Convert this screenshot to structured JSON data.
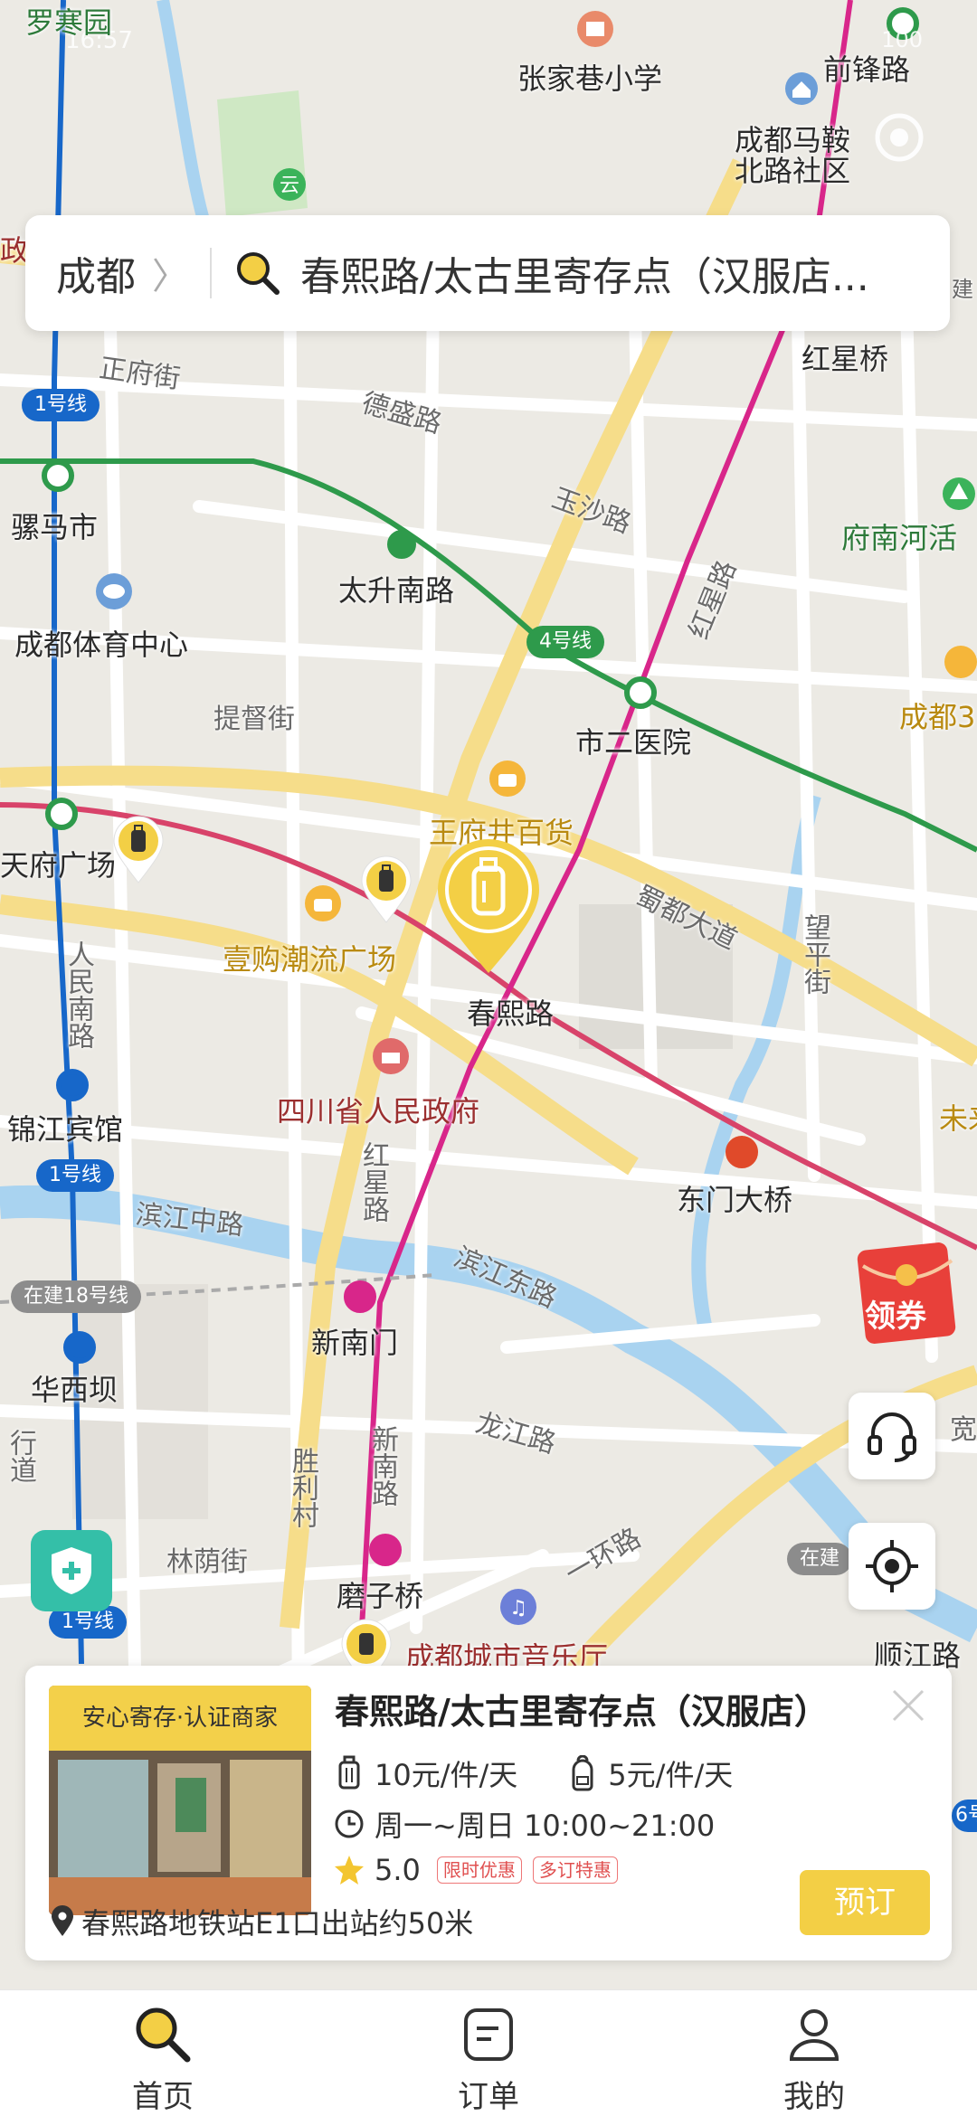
{
  "status_bar": {
    "time": "16:57",
    "battery": "100"
  },
  "search": {
    "city": "成都",
    "query": "春熙路/太古里寄存点（汉服店..."
  },
  "map": {
    "labels": {
      "luohan": "罗寒园",
      "zhangjia": "张家巷小学",
      "qianfeng": "前锋路",
      "mahan": "成都马鞍\n北路社区",
      "zhengfu": "正府街",
      "desheng": "德盛路",
      "hongxingqiao": "红星桥",
      "yusha": "玉沙路",
      "lumashi": "骡马市",
      "funan": "府南河活",
      "taisheng": "太升南路",
      "tiyu": "成都体育中心",
      "hongxing_road": "红星路",
      "chengdu3": "成都3",
      "tidu": "提督街",
      "shier": "市二医院",
      "wangfujing": "王府井百货",
      "tianfu": "天府广场",
      "shudu": "蜀都大道",
      "wangping": "望平街",
      "yigou": "壹购潮流广场",
      "chunxi_station": "春熙路",
      "renmin_nan": "人民南路",
      "sichuan_gov": "四川省人民政府",
      "jinjiang_hotel": "锦江宾馆",
      "weilai": "未来",
      "dongmen": "东门大桥",
      "binjiang_zhong": "滨江中路",
      "binjiang_dong": "滨江东路",
      "xinnanmen": "新南门",
      "huaxiba": "华西坝",
      "longjiang": "龙江路",
      "shengli": "胜利村",
      "xinnan_road": "新南路",
      "linyin": "林荫街",
      "yihuan": "一环路",
      "mozi": "磨子桥",
      "music_hall": "成都城市音乐厅",
      "shunjiang": "顺江路",
      "hongxing_road2": "红星路",
      "xinghang": "行道",
      "kuan": "宽",
      "zaijian_right": "在建",
      "jian": "建",
      "zheng": "政"
    },
    "badges": {
      "line1_top": "1号线",
      "line4": "4号线",
      "line1_mid": "1号线",
      "line18": "在建18号线",
      "line1_bot": "1号线",
      "line6": "6号"
    }
  },
  "coupon_label": "领券",
  "card": {
    "badge": "安心寄存·认证商家",
    "title": "春熙路/太古里寄存点（汉服店）",
    "price_large": "10元/件/天",
    "price_small": "5元/件/天",
    "hours": "周一~周日 10:00~21:00",
    "rating": "5.0",
    "tags": [
      "限时优惠",
      "多订特惠"
    ],
    "address": "春熙路地铁站E1口出站约50米",
    "book_label": "预订"
  },
  "tabs": [
    {
      "label": "首页"
    },
    {
      "label": "订单"
    },
    {
      "label": "我的"
    }
  ],
  "colors": {
    "accent_yellow": "#f3cf45",
    "metro_blue": "#1767c9",
    "metro_green": "#2e9a4b",
    "metro_pink": "#d8268a",
    "metro_red": "#e04a2a",
    "river": "#a9d3f0"
  }
}
